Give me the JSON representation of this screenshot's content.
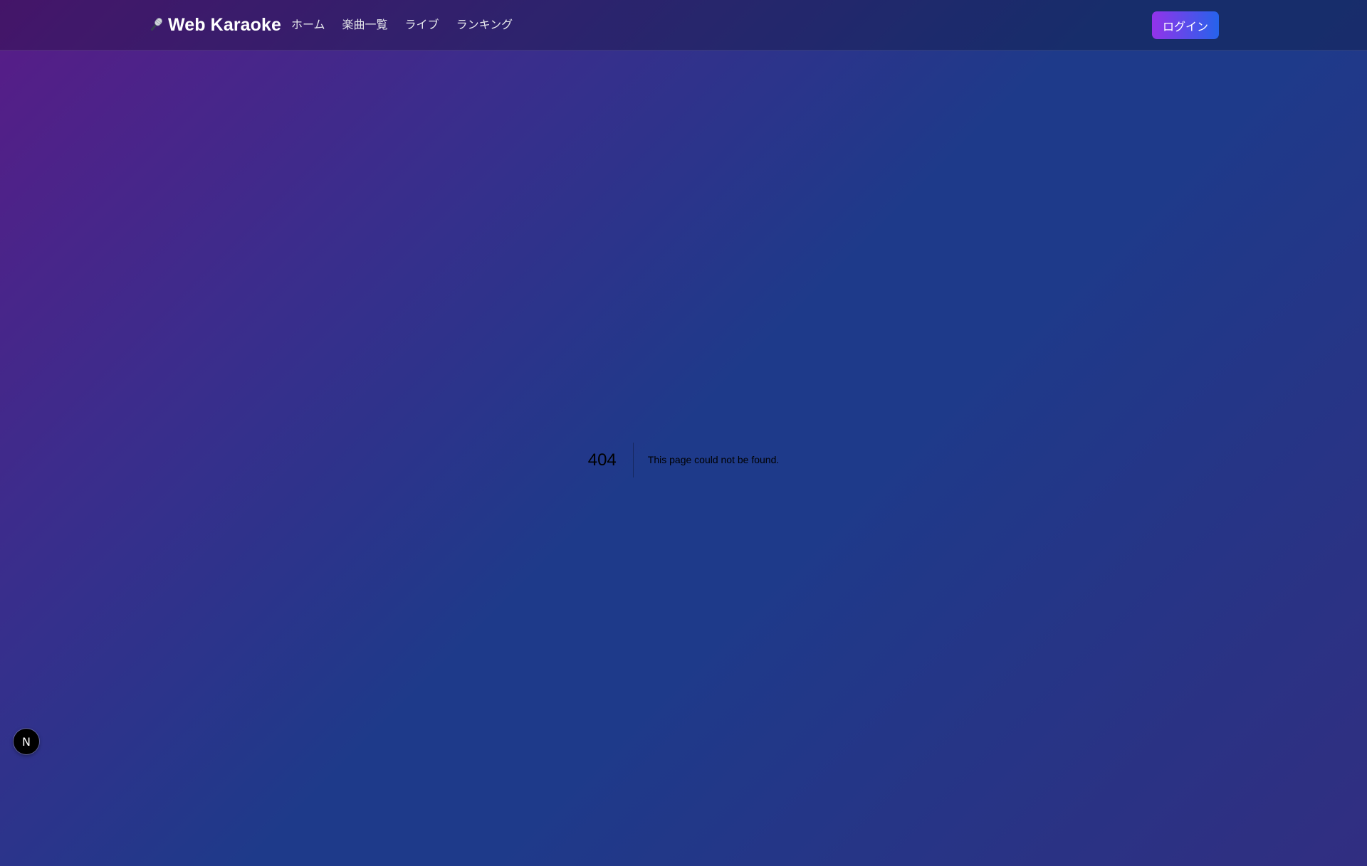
{
  "header": {
    "brand": "Web Karaoke",
    "brand_icon": "microphone-icon",
    "nav": [
      {
        "label": "ホーム"
      },
      {
        "label": "楽曲一覧"
      },
      {
        "label": "ライブ"
      },
      {
        "label": "ランキング"
      }
    ],
    "login_label": "ログイン"
  },
  "error": {
    "code": "404",
    "message": "This page could not be found."
  },
  "dev_badge": {
    "letter": "N",
    "icon": "nextjs-icon"
  },
  "colors": {
    "gradient_start": "#581c87",
    "gradient_mid": "#1e3a8a",
    "button_start": "#9333ea",
    "button_end": "#2563eb"
  }
}
